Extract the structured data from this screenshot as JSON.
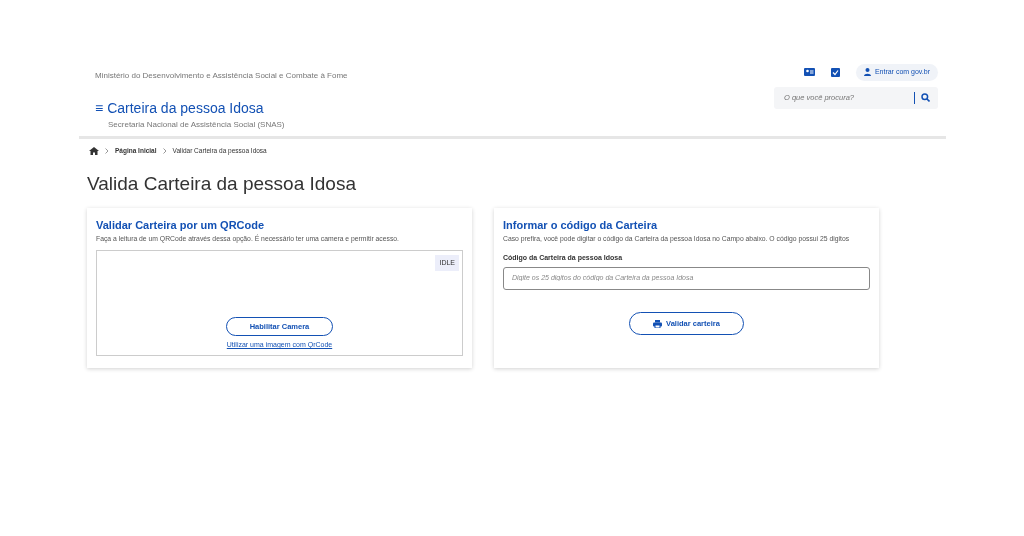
{
  "header": {
    "ministry": "Ministério do Desenvolvimento e Assistência Social e Combate à Fome",
    "login_label": "Entrar com gov.br",
    "menu_glyph": "≡",
    "site_title": "Carteira da pessoa Idosa",
    "site_subtitle": "Secretaria Nacional de Assistência Social (SNAS)",
    "search": {
      "placeholder": "O que você procura?"
    }
  },
  "breadcrumb": [
    {
      "label": "Página Inicial",
      "current": false
    },
    {
      "label": "Validar Carteira da pessoa Idosa",
      "current": true
    }
  ],
  "page_title": "Valida Carteira da pessoa Idosa",
  "qr_card": {
    "title": "Validar Carteira por um QRCode",
    "description": "Faça a leitura de um QRCode através dessa opção. É necessário ter uma camera e permitir acesso.",
    "status": "IDLE",
    "button": "Habilitar Camera",
    "link": "Utilizar uma imagem com QrCode"
  },
  "code_card": {
    "title": "Informar o código da Carteira",
    "description": "Caso prefira, você pode digitar o código da Carteira da pessoa Idosa no Campo abaixo. O código possui 25 digitos",
    "field_label": "Código da Carteira da pessoa Idosa",
    "placeholder": "Digite os 25 digitos do código da Carteira da pessoa Idosa",
    "button": "Validar carteira"
  }
}
